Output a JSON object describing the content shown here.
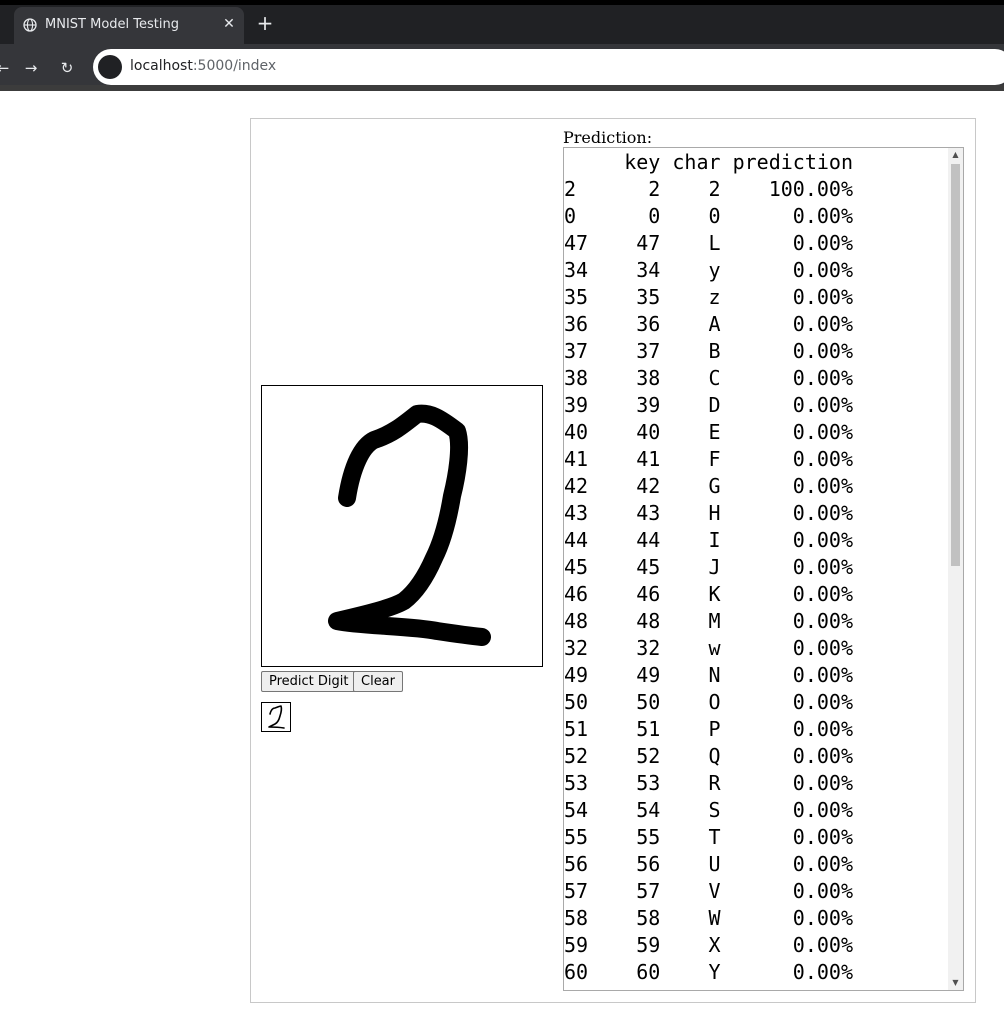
{
  "browser": {
    "tab_title": "MNIST Model Testing",
    "tab_close": "✕",
    "new_tab": "+",
    "url_host": "localhost",
    "url_path": ":5000/index",
    "back": "←",
    "forward": "→",
    "reload": "↻"
  },
  "page": {
    "prediction_label": "Prediction:",
    "predict_button": "Predict Digit",
    "clear_button": "Clear",
    "prediction_columns": [
      "key",
      "char",
      "prediction"
    ],
    "prediction_rows": [
      {
        "index": "2",
        "key": "2",
        "char": "2",
        "prediction": "100.00%"
      },
      {
        "index": "0",
        "key": "0",
        "char": "0",
        "prediction": "0.00%"
      },
      {
        "index": "47",
        "key": "47",
        "char": "L",
        "prediction": "0.00%"
      },
      {
        "index": "34",
        "key": "34",
        "char": "y",
        "prediction": "0.00%"
      },
      {
        "index": "35",
        "key": "35",
        "char": "z",
        "prediction": "0.00%"
      },
      {
        "index": "36",
        "key": "36",
        "char": "A",
        "prediction": "0.00%"
      },
      {
        "index": "37",
        "key": "37",
        "char": "B",
        "prediction": "0.00%"
      },
      {
        "index": "38",
        "key": "38",
        "char": "C",
        "prediction": "0.00%"
      },
      {
        "index": "39",
        "key": "39",
        "char": "D",
        "prediction": "0.00%"
      },
      {
        "index": "40",
        "key": "40",
        "char": "E",
        "prediction": "0.00%"
      },
      {
        "index": "41",
        "key": "41",
        "char": "F",
        "prediction": "0.00%"
      },
      {
        "index": "42",
        "key": "42",
        "char": "G",
        "prediction": "0.00%"
      },
      {
        "index": "43",
        "key": "43",
        "char": "H",
        "prediction": "0.00%"
      },
      {
        "index": "44",
        "key": "44",
        "char": "I",
        "prediction": "0.00%"
      },
      {
        "index": "45",
        "key": "45",
        "char": "J",
        "prediction": "0.00%"
      },
      {
        "index": "46",
        "key": "46",
        "char": "K",
        "prediction": "0.00%"
      },
      {
        "index": "48",
        "key": "48",
        "char": "M",
        "prediction": "0.00%"
      },
      {
        "index": "32",
        "key": "32",
        "char": "w",
        "prediction": "0.00%"
      },
      {
        "index": "49",
        "key": "49",
        "char": "N",
        "prediction": "0.00%"
      },
      {
        "index": "50",
        "key": "50",
        "char": "O",
        "prediction": "0.00%"
      },
      {
        "index": "51",
        "key": "51",
        "char": "P",
        "prediction": "0.00%"
      },
      {
        "index": "52",
        "key": "52",
        "char": "Q",
        "prediction": "0.00%"
      },
      {
        "index": "53",
        "key": "53",
        "char": "R",
        "prediction": "0.00%"
      },
      {
        "index": "54",
        "key": "54",
        "char": "S",
        "prediction": "0.00%"
      },
      {
        "index": "55",
        "key": "55",
        "char": "T",
        "prediction": "0.00%"
      },
      {
        "index": "56",
        "key": "56",
        "char": "U",
        "prediction": "0.00%"
      },
      {
        "index": "57",
        "key": "57",
        "char": "V",
        "prediction": "0.00%"
      },
      {
        "index": "58",
        "key": "58",
        "char": "W",
        "prediction": "0.00%"
      },
      {
        "index": "59",
        "key": "59",
        "char": "X",
        "prediction": "0.00%"
      },
      {
        "index": "60",
        "key": "60",
        "char": "Y",
        "prediction": "0.00%"
      }
    ]
  }
}
